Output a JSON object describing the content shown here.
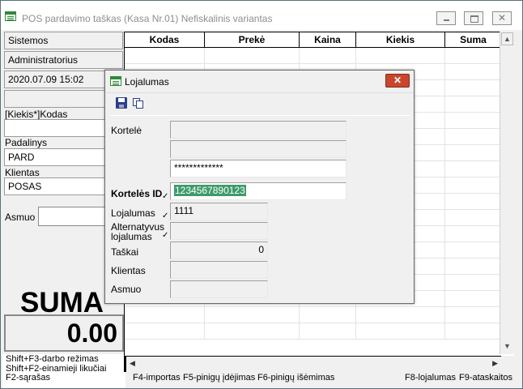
{
  "window": {
    "title": "POS pardavimo taškas (Kasa Nr.01) Nefiskalinis variantas"
  },
  "left_panel": {
    "system": "Sistemos",
    "user": "Administratorius",
    "datetime": "2020.07.09 15:02",
    "kiekis_kodas_label": "[Kiekis*]Kodas",
    "padalinys_label": "Padalinys",
    "padalinys_value": "PARD",
    "klientas_label": "Klientas",
    "klientas_value": "POSAS",
    "asmuo_label": "Asmuo",
    "suma_label": "SUMA",
    "suma_value": "0.00"
  },
  "hints": {
    "line1": "Shift+F3-darbo režimas",
    "line2": "Shift+F2-einamieji likučiai",
    "line3": "F2-sąrašas"
  },
  "grid": {
    "columns": [
      "Kodas",
      "Prekė",
      "Kaina",
      "Kiekis",
      "Suma"
    ]
  },
  "function_keys": {
    "f4": "F4-importas",
    "f5": "F5-pinigų įdėjimas",
    "f6": "F6-pinigų išėmimas",
    "f8": "F8-lojalumas",
    "f9": "F9-ataskaitos"
  },
  "dialog": {
    "title": "Lojalumas",
    "kortele_label": "Kortelė",
    "kortele_masked": "*************",
    "korteles_id_label": "Kortelės ID",
    "korteles_id_value": "1234567890123",
    "lojalumas_label": "Lojalumas",
    "lojalumas_value": "1111",
    "alternatyvus_label_1": "Alternatyvus",
    "alternatyvus_label_2": "lojalumas",
    "taskai_label": "Taškai",
    "taskai_value": "0",
    "klientas_label": "Klientas",
    "asmuo_label": "Asmuo",
    "check_mark": "✓"
  }
}
